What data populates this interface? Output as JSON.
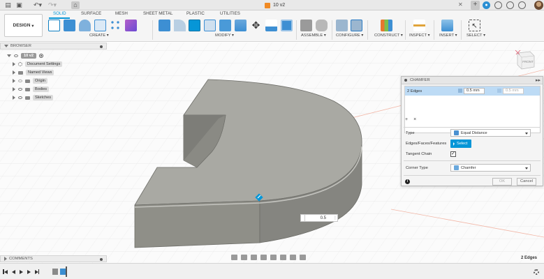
{
  "app": {
    "document_title": "10 v2"
  },
  "toolbar": {
    "workspace": "DESIGN",
    "tabs": [
      "SOLID",
      "SURFACE",
      "MESH",
      "SHEET METAL",
      "PLASTIC",
      "UTILITIES"
    ],
    "active_tab": "SOLID",
    "groups": [
      "CREATE",
      "MODIFY",
      "ASSEMBLE",
      "CONFIGURE",
      "CONSTRUCT",
      "INSPECT",
      "INSERT",
      "SELECT"
    ]
  },
  "browser": {
    "title": "BROWSER",
    "root": "10 v2",
    "items": [
      "Document Settings",
      "Named Views",
      "Origin",
      "Bodies",
      "Sketches"
    ]
  },
  "comments": {
    "title": "COMMENTS"
  },
  "chamfer_panel": {
    "title": "CHAMFER",
    "edge_row_label": "2 Edges",
    "distance_value": "0.5 mm",
    "distance_value_2": "0.5 mm",
    "add_symbol": "+",
    "remove_symbol": "×",
    "type_label": "Type",
    "type_value": "Equal Distance",
    "selection_label": "Edges/Faces/Features",
    "select_button": "Select",
    "tangent_label": "Tangent Chain",
    "tangent_checked": "✓",
    "corner_label": "Corner Type",
    "corner_value": "Chamfer",
    "ok_label": "OK",
    "cancel_label": "Cancel",
    "info_symbol": "i"
  },
  "canvas": {
    "distance_input": "0.5",
    "selection_status": "2 Edges",
    "viewcube_face": "FRONT"
  },
  "colors": {
    "accent": "#0696d7",
    "body_face": "#8f8f88",
    "body_top": "#a9a9a3"
  }
}
